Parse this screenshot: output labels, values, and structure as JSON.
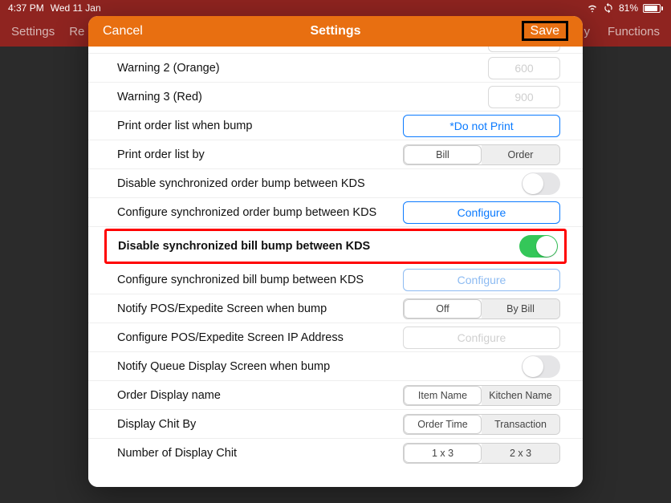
{
  "status": {
    "time": "4:37 PM",
    "date": "Wed 11 Jan",
    "battery": "81%"
  },
  "bgnav": {
    "left1": "Settings",
    "left2": "Re",
    "rightY": "y",
    "right2": "Functions"
  },
  "modal": {
    "cancel": "Cancel",
    "title": "Settings",
    "save": "Save"
  },
  "rows": {
    "w2": {
      "label": "Warning 2 (Orange)",
      "value": "600"
    },
    "w3": {
      "label": "Warning 3 (Red)",
      "value": "900"
    },
    "printBump": {
      "label": "Print order list when bump",
      "btn": "*Do not Print"
    },
    "printBy": {
      "label": "Print order list by",
      "a": "Bill",
      "b": "Order"
    },
    "disOrder": {
      "label": "Disable synchronized order bump between KDS"
    },
    "confOrder": {
      "label": "Configure synchronized order bump between KDS",
      "btn": "Configure"
    },
    "disBill": {
      "label": "Disable synchronized bill bump between KDS"
    },
    "confBill": {
      "label": "Configure synchronized bill bump between KDS",
      "btn": "Configure"
    },
    "notifyPOS": {
      "label": "Notify POS/Expedite Screen when bump",
      "a": "Off",
      "b": "By Bill"
    },
    "confPOSIP": {
      "label": "Configure POS/Expedite Screen IP Address",
      "btn": "Configure"
    },
    "notifyQ": {
      "label": "Notify Queue Display Screen when bump"
    },
    "orderName": {
      "label": "Order Display name",
      "a": "Item Name",
      "b": "Kitchen Name"
    },
    "chitBy": {
      "label": "Display Chit By",
      "a": "Order Time",
      "b": "Transaction"
    },
    "numChit": {
      "label": "Number of Display Chit",
      "a": "1 x 3",
      "b": "2 x 3"
    }
  }
}
